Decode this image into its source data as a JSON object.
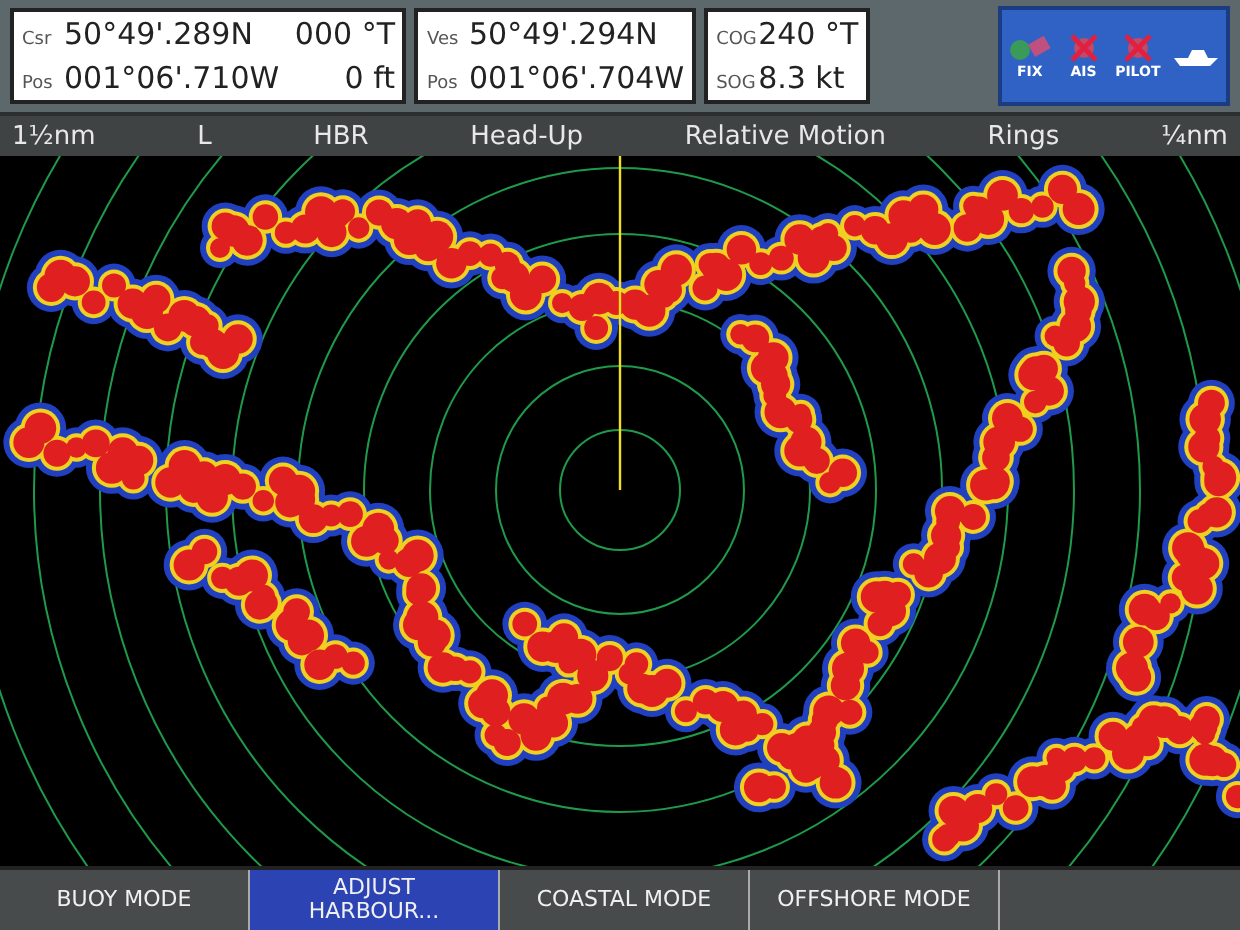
{
  "data_boxes": [
    {
      "rows": [
        {
          "label": "Csr",
          "value": "50°49'.289N",
          "extra": "000 °T"
        },
        {
          "label": "Pos",
          "value": "001°06'.710W",
          "extra": "0 ft"
        }
      ]
    },
    {
      "rows": [
        {
          "label": "Ves",
          "value": "50°49'.294N"
        },
        {
          "label": "Pos",
          "value": "001°06'.704W"
        }
      ]
    },
    {
      "rows": [
        {
          "label": "COG",
          "value": "240 °T"
        },
        {
          "label": "SOG",
          "value": "8.3 kt"
        }
      ]
    }
  ],
  "status_icons": [
    {
      "kind": "fix",
      "label": "FIX",
      "crossed": false
    },
    {
      "kind": "ais",
      "label": "AIS",
      "crossed": true
    },
    {
      "kind": "pilot",
      "label": "PILOT",
      "crossed": true
    }
  ],
  "status_bar": [
    "1½nm",
    "L",
    "HBR",
    "Head-Up",
    "Relative Motion",
    "Rings",
    "¼nm"
  ],
  "soft_keys": [
    {
      "label": "BUOY MODE",
      "selected": false
    },
    {
      "label": "ADJUST HARBOUR...",
      "selected": true
    },
    {
      "label": "COASTAL MODE",
      "selected": false
    },
    {
      "label": "OFFSHORE MODE",
      "selected": false
    }
  ]
}
